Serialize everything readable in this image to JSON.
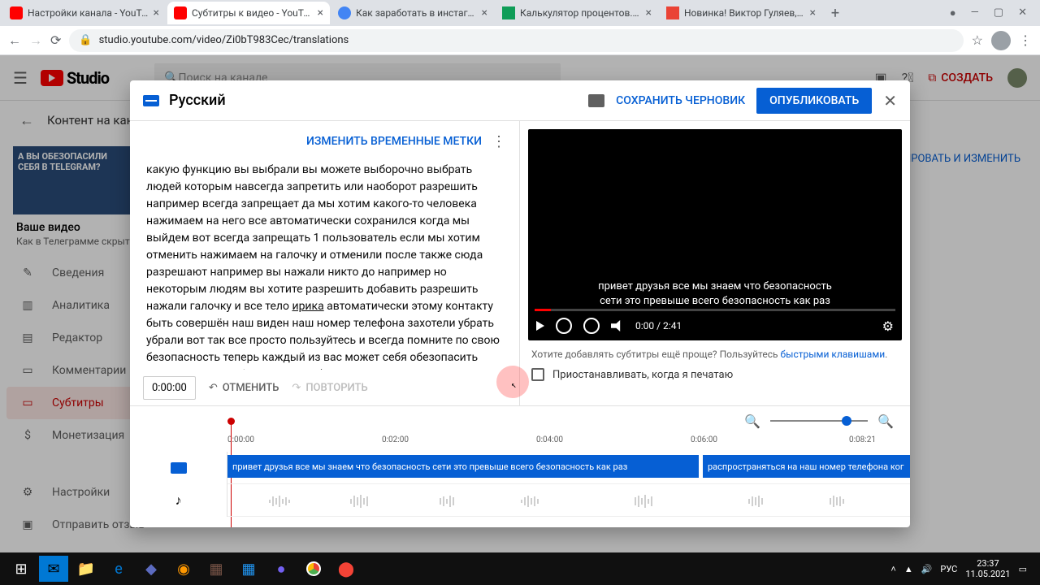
{
  "browser": {
    "tabs": [
      {
        "title": "Настройки канала - YouTube St"
      },
      {
        "title": "Субтитры к видео - YouTube St"
      },
      {
        "title": "Как заработать в инстаграм | 8"
      },
      {
        "title": "Калькулятор процентов. Проце"
      },
      {
        "title": "Новинка! Виктор Гуляев, добав"
      }
    ],
    "url": "studio.youtube.com/video/Zi0bT983Cec/translations"
  },
  "studio": {
    "logo": "Studio",
    "search_ph": "Поиск на канале",
    "create": "СОЗДАТЬ",
    "content_hdr": "Контент на канал",
    "thumb_text": "А ВЫ ОБЕЗОПАСИЛИ СЕБЯ В TELEGRAM?",
    "video_title": "Ваше видео",
    "video_sub": "Как в Телеграмме скрыть св",
    "menu": {
      "details": "Сведения",
      "analytics": "Аналитика",
      "editor": "Редактор",
      "comments": "Комментарии",
      "subtitles": "Субтитры",
      "monetize": "Монетизация",
      "settings": "Настройки",
      "feedback": "Отправить отзыв"
    },
    "main_link": "КОПИРОВАТЬ И ИЗМЕНИТЬ"
  },
  "modal": {
    "lang": "Русский",
    "save_draft": "СОХРАНИТЬ ЧЕРНОВИК",
    "publish": "ОПУБЛИКОВАТЬ",
    "edit_timings": "ИЗМЕНИТЬ ВРЕМЕННЫЕ МЕТКИ",
    "editor_text_a": "какую функцию вы выбрали вы можете выборочно выбрать людей которым навсегда запретить или наоборот разрешить например всегда запрещает да мы хотим какого-то человека нажимаем на него все автоматически сохранился когда мы выйдем вот всегда запрещать 1 пользователь если мы хотим отменить нажимаем на галочку и отменили после также сюда разрешают например вы нажали никто до например но некоторым людям вы хотите разрешить добавить разрешить нажали галочку и все тело ",
    "editor_under": "ирика",
    "editor_text_b": " автоматически этому контакту быть совершён наш виден наш номер телефона захотели убрать убрали вот так все просто пользуйтесь и всегда помните по свою безопасность теперь каждый из вас может себя обезопасить скрыть свой телефон и уже его будут видеть только те люди которые вы по желанию чтобы его видели надо у меня все спасибо за внимание всем пока до скорых встреч",
    "time_input": "0:00:00",
    "undo": "ОТМЕНИТЬ",
    "redo": "ПОВТОРИТЬ",
    "caption_l1": "привет друзья все мы знаем что безопасность",
    "caption_l2": "сети это превыше всего безопасность как раз",
    "time_current": "0:00",
    "time_total": "2:41",
    "hint": "Хотите добавлять субтитры ещё проще? Пользуйтесь ",
    "hint_link": "быстрыми клавишами",
    "pause": "Приостанавливать, когда я печатаю",
    "ticks": [
      "0:00:00",
      "0:02:00",
      "0:04:00",
      "0:06:00",
      "0:08:21"
    ],
    "clip1": "привет друзья все мы знаем что безопасность  сети это превыше всего безопасность как раз",
    "clip2": "распространяться на наш номер телефона ког"
  },
  "tray": {
    "lang": "РУС",
    "time": "23:37",
    "date": "11.05.2021"
  }
}
